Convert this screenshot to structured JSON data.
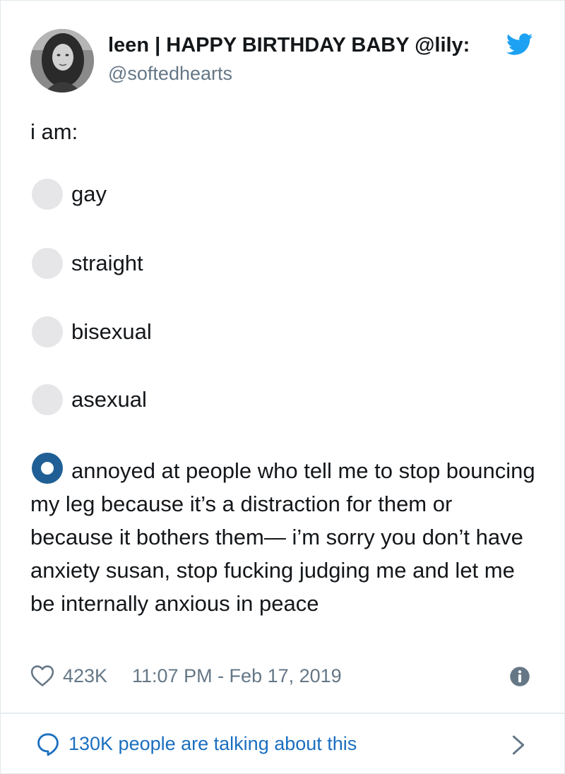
{
  "tweet": {
    "author": {
      "display_name": "leen | HAPPY BIRTHDAY BABY @lily:",
      "handle": "@softedhearts",
      "avatar_icon": "avatar-photo"
    },
    "text": "i am:",
    "poll": {
      "options": [
        {
          "label": "gay",
          "selected": false
        },
        {
          "label": "straight",
          "selected": false
        },
        {
          "label": "bisexual",
          "selected": false
        },
        {
          "label": "asexual",
          "selected": false
        },
        {
          "label": "annoyed at people who tell me to stop bouncing my leg because it’s a distraction for them or because it bothers them— i’m sorry you don’t have anxiety susan, stop fucking judging me and let me be internally anxious in peace",
          "selected": true
        }
      ]
    },
    "likes": "423K",
    "timestamp": "11:07 PM - Feb 17, 2019",
    "conversation": "130K people are talking about this"
  },
  "icons": {
    "brand": "twitter-bird-icon",
    "like": "heart-icon",
    "info": "info-icon",
    "conversation": "speech-bubble-icon",
    "more": "chevron-right-icon"
  },
  "colors": {
    "twitter_blue": "#1da1f2",
    "selected_radio": "#1f5f95",
    "unselected_radio": "#e6e6e9",
    "link_blue": "#1b6fbf",
    "secondary_text": "#657786"
  }
}
